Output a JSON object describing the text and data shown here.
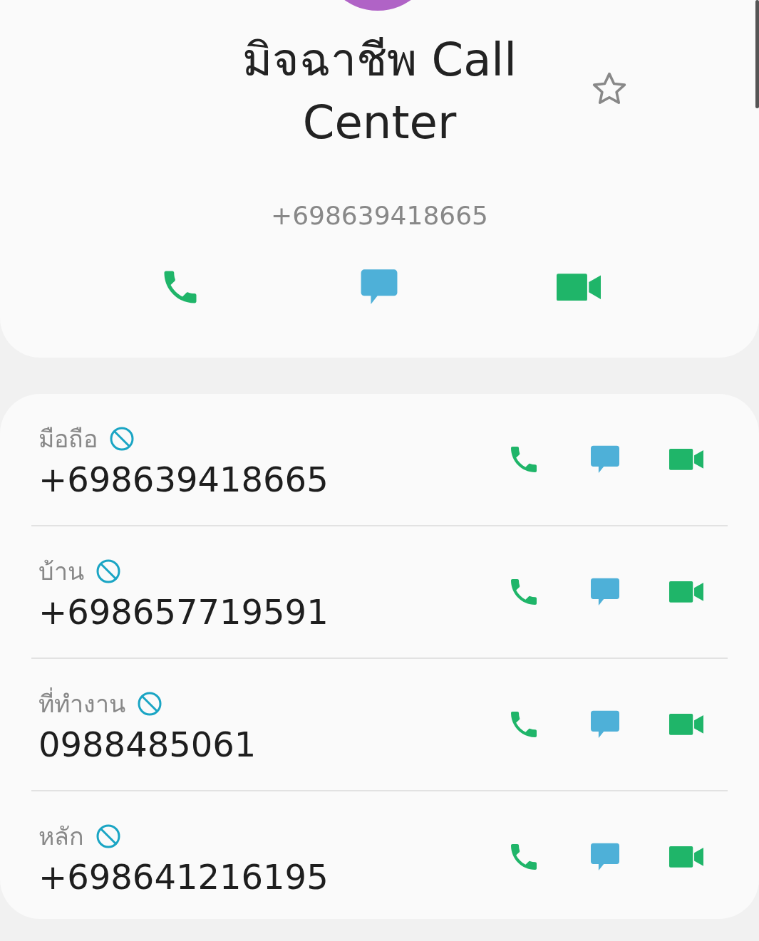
{
  "contact": {
    "name": "มิจฉาชีพ Call Center",
    "favorite": false,
    "number": "+698639418665"
  },
  "numbers": [
    {
      "label": "มือถือ",
      "blocked": true,
      "number": "+698639418665"
    },
    {
      "label": "บ้าน",
      "blocked": true,
      "number": "+698657719591"
    },
    {
      "label": "ที่ทำงาน",
      "blocked": true,
      "number": "0988485061"
    },
    {
      "label": "หลัก",
      "blocked": true,
      "number": "+698641216195"
    }
  ]
}
